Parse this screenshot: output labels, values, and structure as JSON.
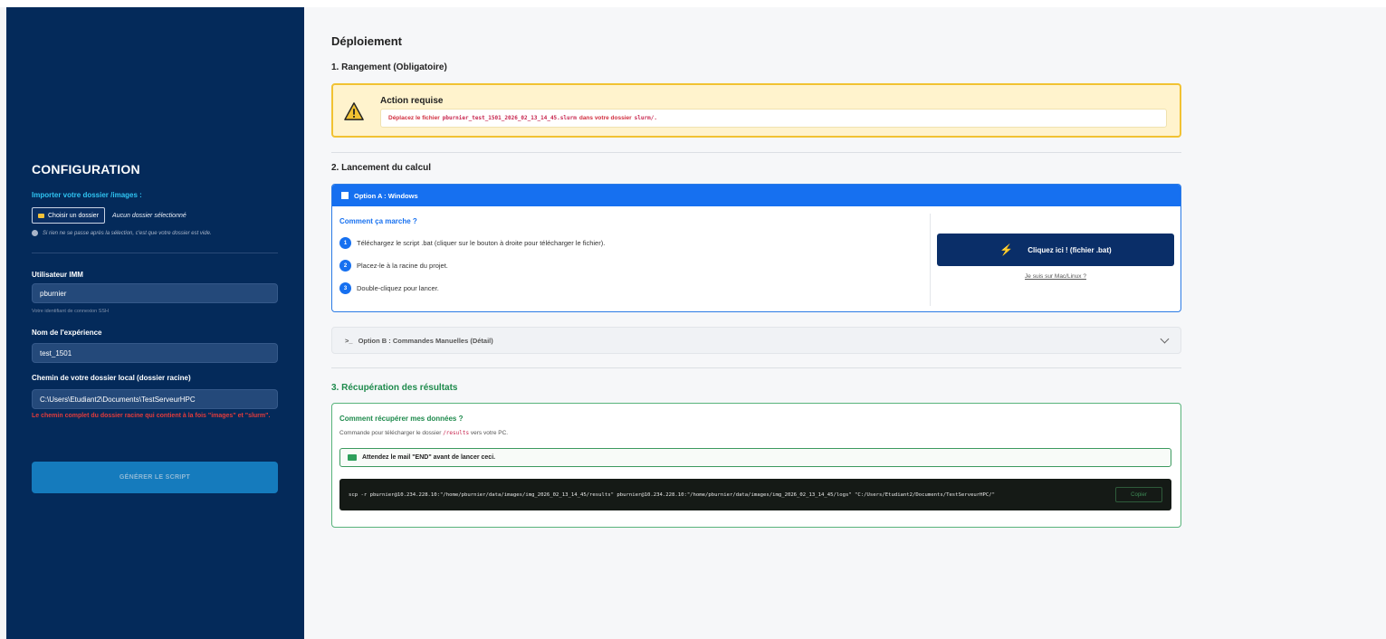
{
  "sidebar": {
    "title": "CONFIGURATION",
    "import_label": "Importer votre dossier /images :",
    "choose_button": "Choisir un dossier",
    "file_status": "Aucun dossier sélectionné",
    "hint": "Si rien ne se passe après la sélection, c'est que votre dossier est vide.",
    "user_label": "Utilisateur IMM",
    "user_value": "pburnier",
    "user_sub": "Votre identifiant de connexion SSH",
    "exp_label": "Nom de l'expérience",
    "exp_value": "test_1501",
    "path_label": "Chemin de votre dossier local (dossier racine)",
    "path_value": "C:\\Users\\Etudiant2\\Documents\\TestServeurHPC",
    "path_error": "Le chemin complet du dossier racine qui contient à la fois \"images\" et \"slurm\".",
    "generate_button": "GÉNÉRER LE SCRIPT"
  },
  "main": {
    "title": "Déploiement",
    "section1": "1. Rangement (Obligatoire)",
    "warning": {
      "title": "Action requise",
      "msg_prefix": "Déplacez le fichier",
      "filename": "pburnier_test_1501_2026_02_13_14_45.slurm",
      "msg_middle": "dans votre dossier",
      "folder": "slurm/."
    },
    "section2": "2. Lancement du calcul",
    "optionA": {
      "header": "Option A : Windows",
      "how_title": "Comment ça marche ?",
      "steps": [
        {
          "num": "1",
          "text": "Téléchargez le script .bat (cliquer sur le bouton à droite pour télécharger le fichier)."
        },
        {
          "num": "2",
          "text": "Placez-le à la racine du projet."
        },
        {
          "num": "3",
          "text": "Double-cliquez pour lancer."
        }
      ],
      "bat_button": "Cliquez ici ! (fichier .bat)",
      "mac_link": "Je suis sur Mac/Linux ?"
    },
    "optionB": {
      "prompt": ">_",
      "header": "Option B : Commandes Manuelles (Détail)"
    },
    "section3": "3. Récupération des résultats",
    "results": {
      "title": "Comment récupérer mes données ?",
      "sub_prefix": "Commande pour télécharger le dossier",
      "sub_code": "/results",
      "sub_suffix": "vers votre PC.",
      "alert": "Attendez le mail \"END\" avant de lancer ceci.",
      "command": "scp -r pburnier@10.234.228.10:\"/home/pburnier/data/images/img_2026_02_13_14_45/results\" pburnier@10.234.228.10:\"/home/pburnier/data/images/img_2026_02_13_14_45/logs\" \"C:/Users/Etudiant2/Documents/TestServeurHPC/\"",
      "copy_button": "Copier"
    }
  },
  "colors": {
    "sidebar_bg": "#042a5a",
    "accent_blue": "#1670f0",
    "warning_border": "#f1c232",
    "success_green": "#1e8a4c",
    "error_red": "#e23b3b"
  }
}
